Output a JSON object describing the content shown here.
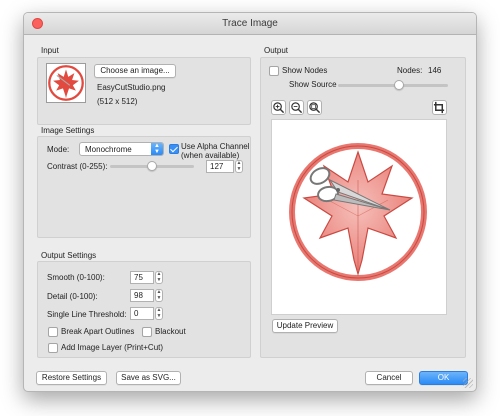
{
  "window": {
    "title": "Trace Image"
  },
  "input": {
    "section_label": "Input",
    "choose_button": "Choose an image...",
    "filename": "EasyCutStudio.png",
    "dimensions": "(512 x 512)"
  },
  "image_settings": {
    "section_label": "Image Settings",
    "mode_label": "Mode:",
    "mode_value": "Monochrome",
    "use_alpha_label_1": "Use Alpha Channel",
    "use_alpha_label_2": "(when available)",
    "use_alpha_checked": true,
    "contrast_label": "Contrast (0-255):",
    "contrast_value": "127",
    "contrast_level": 127
  },
  "output_settings": {
    "section_label": "Output Settings",
    "smooth_label": "Smooth (0-100):",
    "smooth_value": "75",
    "detail_label": "Detail (0-100):",
    "detail_value": "98",
    "threshold_label": "Single Line Threshold:",
    "threshold_value": "0",
    "break_apart_label": "Break Apart Outlines",
    "blackout_label": "Blackout",
    "add_image_layer_label": "Add Image Layer (Print+Cut)"
  },
  "output": {
    "section_label": "Output",
    "show_nodes_label": "Show Nodes",
    "nodes_label": "Nodes:",
    "nodes_value": "146",
    "show_source_label": "Show Source",
    "show_source_level": 0.55,
    "update_preview_button": "Update Preview"
  },
  "footer": {
    "restore_button": "Restore Settings",
    "save_svg_button": "Save as SVG...",
    "cancel_button": "Cancel",
    "ok_button": "OK"
  },
  "colors": {
    "accent": "#2b8bf6",
    "logo_red": "#e24a3f",
    "logo_pink": "#f0a09a",
    "close_red": "#fc605c"
  },
  "icons": [
    "zoom-in-icon",
    "zoom-out-icon",
    "zoom-fit-icon",
    "crop-icon",
    "maple-leaf-scissors-logo"
  ]
}
